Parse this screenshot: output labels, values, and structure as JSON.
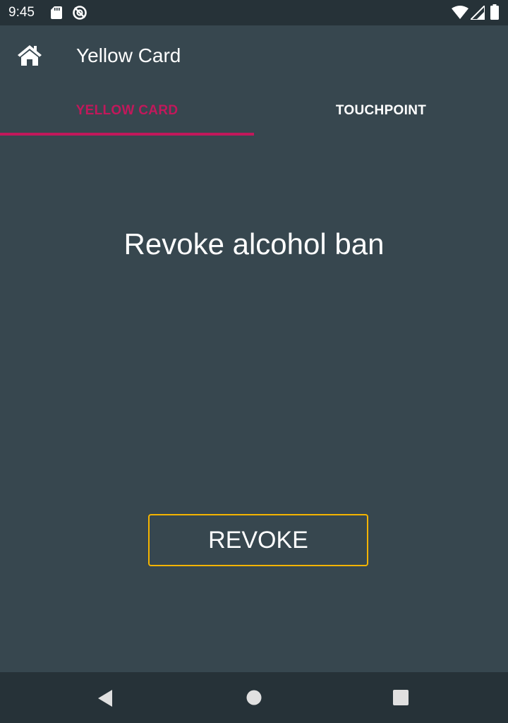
{
  "status_bar": {
    "time": "9:45",
    "icons": [
      "sd-card-icon",
      "no-sync-icon",
      "wifi-icon",
      "signal-icon",
      "battery-icon"
    ]
  },
  "app_bar": {
    "home_icon": "home-icon",
    "title": "Yellow Card"
  },
  "tabs": [
    {
      "label": "YELLOW CARD",
      "selected": true
    },
    {
      "label": "TOUCHPOINT",
      "selected": false
    }
  ],
  "main": {
    "message": "Revoke alcohol ban",
    "revoke_button_label": "REVOKE"
  },
  "nav_bar": {
    "icons": [
      "back-icon",
      "home-circle-icon",
      "recents-icon"
    ]
  },
  "colors": {
    "background": "#37474f",
    "status_bar": "#263238",
    "accent_tab": "#c2185b",
    "button_border": "#f4b400",
    "text": "#ffffff"
  }
}
